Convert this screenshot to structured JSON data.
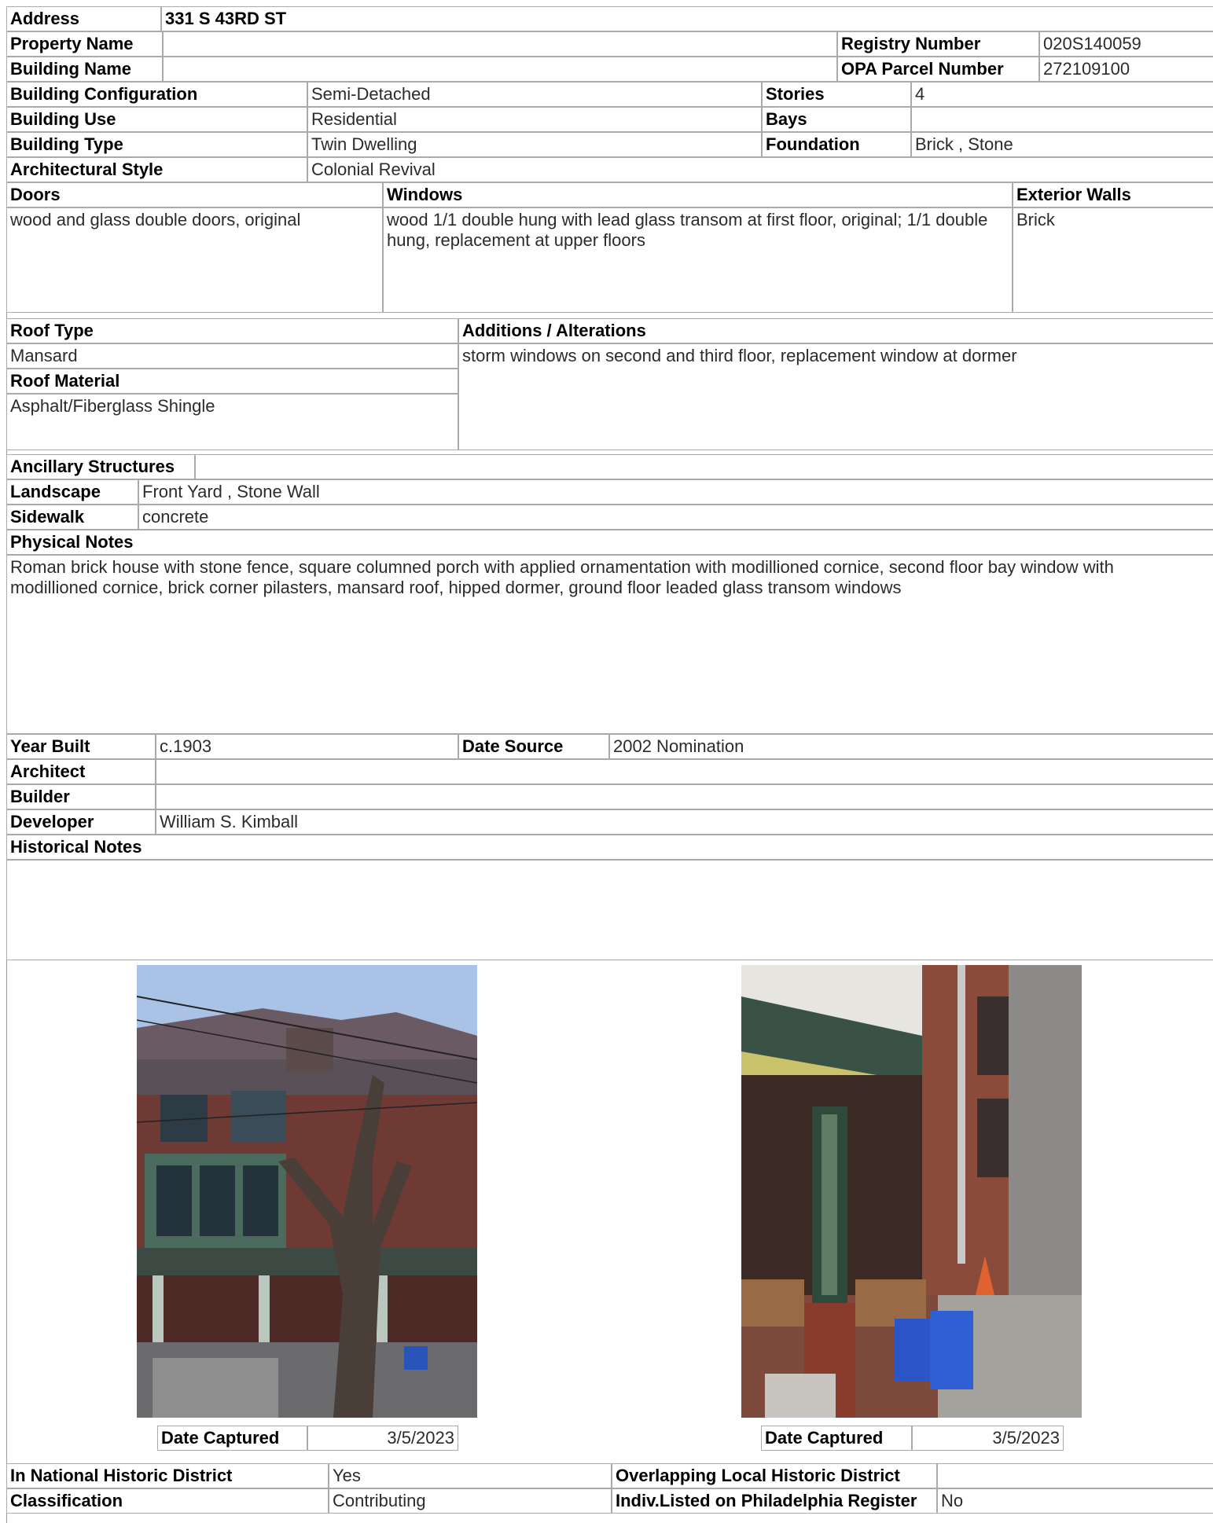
{
  "address": {
    "label": "Address",
    "value": "331 S 43RD ST"
  },
  "property_name": {
    "label": "Property Name",
    "value": ""
  },
  "building_name": {
    "label": "Building Name",
    "value": ""
  },
  "registry_number": {
    "label": "Registry Number",
    "value": "020S140059"
  },
  "opa_parcel_number": {
    "label": "OPA Parcel Number",
    "value": "272109100"
  },
  "building_configuration": {
    "label": "Building Configuration",
    "value": "Semi-Detached"
  },
  "building_use": {
    "label": "Building Use",
    "value": "Residential"
  },
  "building_type": {
    "label": "Building Type",
    "value": "Twin Dwelling"
  },
  "architectural_style": {
    "label": "Architectural Style",
    "value": "Colonial Revival"
  },
  "stories": {
    "label": "Stories",
    "value": "4"
  },
  "bays": {
    "label": "Bays",
    "value": ""
  },
  "foundation": {
    "label": "Foundation",
    "value": "Brick , Stone"
  },
  "doors": {
    "label": "Doors",
    "value": "wood and glass double doors, original"
  },
  "windows": {
    "label": "Windows",
    "value": "wood 1/1 double hung with lead glass transom at first floor, original; 1/1 double hung, replacement at upper floors"
  },
  "exterior_walls": {
    "label": "Exterior Walls",
    "value": "Brick"
  },
  "roof_type": {
    "label": "Roof Type",
    "value": "Mansard"
  },
  "roof_material": {
    "label": "Roof Material",
    "value": "Asphalt/Fiberglass Shingle"
  },
  "additions": {
    "label": "Additions / Alterations",
    "value": "storm windows on second and third floor, replacement window at dormer"
  },
  "ancillary": {
    "label": "Ancillary Structures",
    "value": ""
  },
  "landscape": {
    "label": "Landscape",
    "value": "Front Yard , Stone Wall"
  },
  "sidewalk": {
    "label": "Sidewalk",
    "value": "concrete"
  },
  "physical_notes": {
    "label": "Physical Notes",
    "value": "Roman brick house with stone fence, square columned porch with applied ornamentation with modillioned cornice, second floor bay window with modillioned cornice, brick corner pilasters, mansard roof, hipped dormer, ground floor leaded glass transom windows"
  },
  "year_built": {
    "label": "Year Built",
    "value": "c.1903"
  },
  "date_source": {
    "label": "Date Source",
    "value": "2002 Nomination"
  },
  "architect": {
    "label": "Architect",
    "value": ""
  },
  "builder": {
    "label": "Builder",
    "value": ""
  },
  "developer": {
    "label": "Developer",
    "value": "William S. Kimball"
  },
  "historical_notes": {
    "label": "Historical Notes",
    "value": ""
  },
  "photos": [
    {
      "date_label": "Date Captured",
      "date_value": "3/5/2023"
    },
    {
      "date_label": "Date Captured",
      "date_value": "3/5/2023"
    }
  ],
  "national_district": {
    "label": "In National Historic District",
    "value": "Yes"
  },
  "local_district": {
    "label": "Overlapping Local Historic District",
    "value": ""
  },
  "classification": {
    "label": "Classification",
    "value": "Contributing"
  },
  "indiv_listed": {
    "label": "Indiv.Listed on Philadelphia Register",
    "value": "No"
  }
}
